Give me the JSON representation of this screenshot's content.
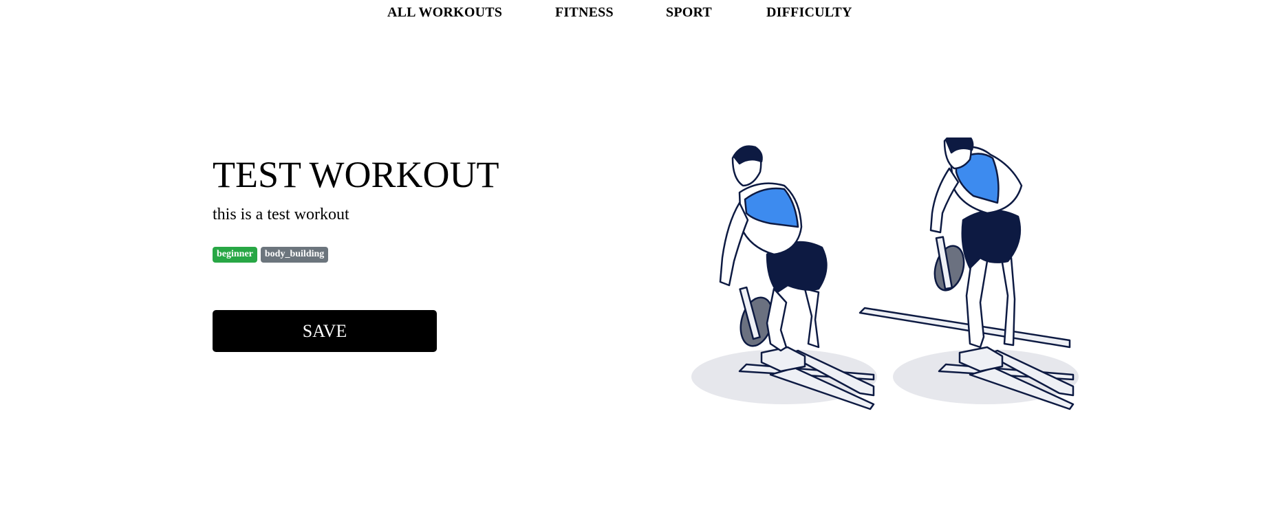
{
  "nav": {
    "items": [
      {
        "label": "ALL WORKOUTS"
      },
      {
        "label": "FITNESS"
      },
      {
        "label": "SPORT"
      },
      {
        "label": "DIFFICULTY"
      }
    ]
  },
  "workout": {
    "title": "TEST WORKOUT",
    "description": "this is a test workout",
    "tags": [
      {
        "label": "beginner",
        "color": "#28a745"
      },
      {
        "label": "body_building",
        "color": "#6c757d"
      }
    ],
    "save_label": "SAVE"
  },
  "illustration": {
    "subject": "t-bar-row-exercise",
    "colors": {
      "shirt": "#3d8bef",
      "shorts": "#0d1a42",
      "outline": "#0d1a42",
      "plate": "#6b7180",
      "equipment": "#eef0f5",
      "shadow": "#e6e7ec"
    }
  }
}
